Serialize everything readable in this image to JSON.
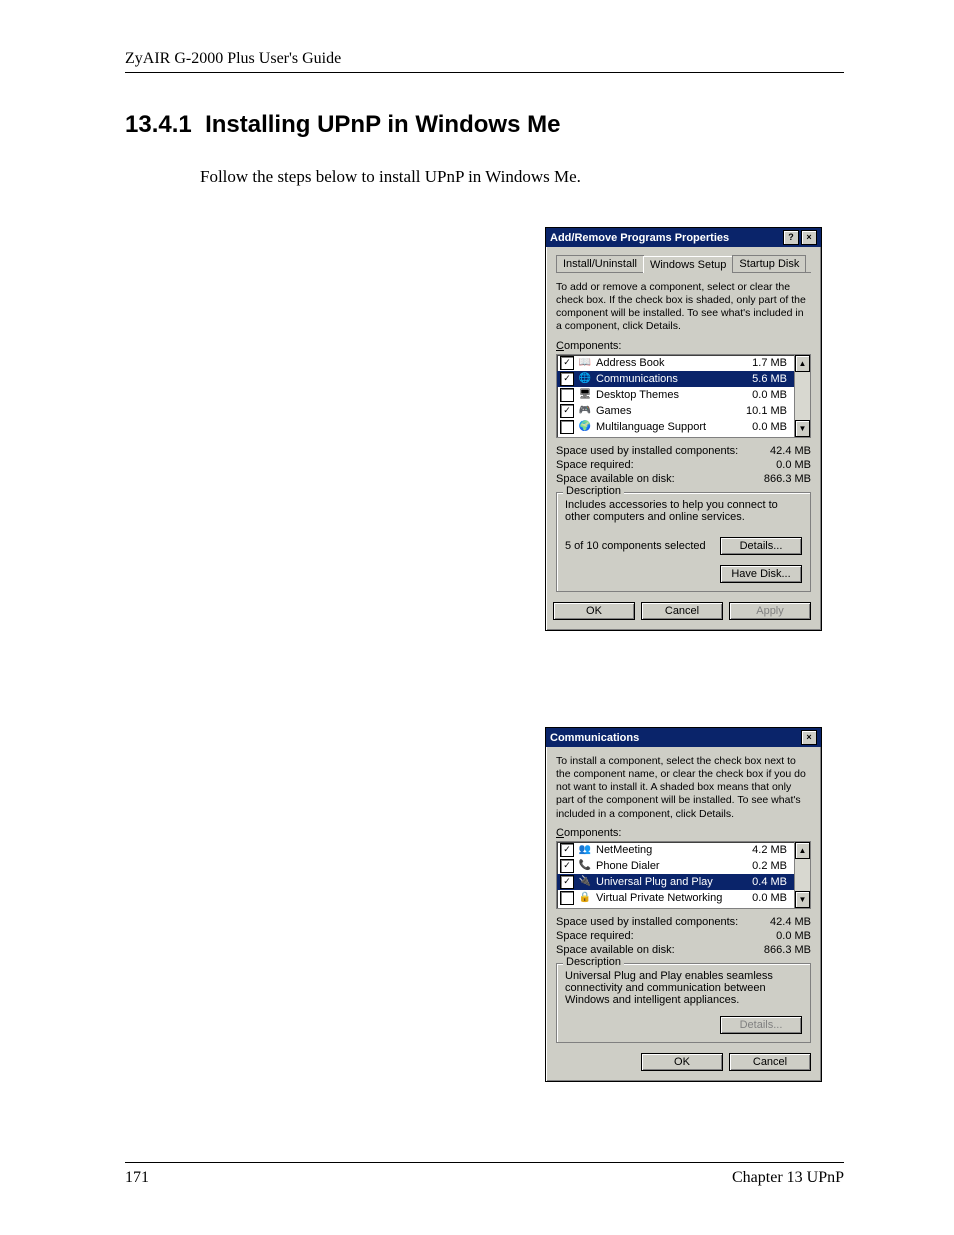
{
  "header": "ZyAIR G-2000 Plus User's Guide",
  "section_number": "13.4.1",
  "section_title": "Installing UPnP in Windows Me",
  "intro": "Follow the steps below to install UPnP in Windows Me.",
  "footer_left": "171",
  "footer_right": "Chapter 13 UPnP",
  "dialog1": {
    "title": "Add/Remove Programs Properties",
    "tabs": [
      "Install/Uninstall",
      "Windows Setup",
      "Startup Disk"
    ],
    "active_tab": 1,
    "hint": "To add or remove a component, select or clear the check box. If the check box is shaded, only part of the component will be installed. To see what's included in a component, click Details.",
    "components_label": "Components:",
    "items": [
      {
        "checked": true,
        "icon": "📖",
        "name": "Address Book",
        "size": "1.7 MB",
        "selected": false
      },
      {
        "checked": true,
        "icon": "🌐",
        "name": "Communications",
        "size": "5.6 MB",
        "selected": true
      },
      {
        "checked": false,
        "icon": "🖥",
        "name": "Desktop Themes",
        "size": "0.0 MB",
        "selected": false
      },
      {
        "checked": true,
        "icon": "🎮",
        "name": "Games",
        "size": "10.1 MB",
        "selected": false
      },
      {
        "checked": false,
        "icon": "🌍",
        "name": "Multilanguage Support",
        "size": "0.0 MB",
        "selected": false
      }
    ],
    "stats": [
      {
        "label": "Space used by installed components:",
        "value": "42.4 MB"
      },
      {
        "label": "Space required:",
        "value": "0.0 MB"
      },
      {
        "label": "Space available on disk:",
        "value": "866.3 MB"
      }
    ],
    "desc_label": "Description",
    "description": "Includes accessories to help you connect to other computers and online services.",
    "selected_text": "5 of 10 components selected",
    "details_btn": "Details...",
    "have_disk_btn": "Have Disk...",
    "ok": "OK",
    "cancel": "Cancel",
    "apply": "Apply"
  },
  "dialog2": {
    "title": "Communications",
    "hint": "To install a component, select the check box next to the component name, or clear the check box if you do not want to install it. A shaded box means that only part of the component will be installed. To see what's included in a component, click Details.",
    "components_label": "Components:",
    "items": [
      {
        "checked": true,
        "icon": "👥",
        "name": "NetMeeting",
        "size": "4.2 MB",
        "selected": false
      },
      {
        "checked": true,
        "icon": "📞",
        "name": "Phone Dialer",
        "size": "0.2 MB",
        "selected": false
      },
      {
        "checked": true,
        "icon": "🔌",
        "name": "Universal Plug and Play",
        "size": "0.4 MB",
        "selected": true
      },
      {
        "checked": false,
        "icon": "🔒",
        "name": "Virtual Private Networking",
        "size": "0.0 MB",
        "selected": false
      }
    ],
    "stats": [
      {
        "label": "Space used by installed components:",
        "value": "42.4 MB"
      },
      {
        "label": "Space required:",
        "value": "0.0 MB"
      },
      {
        "label": "Space available on disk:",
        "value": "866.3 MB"
      }
    ],
    "desc_label": "Description",
    "description": "Universal Plug and Play enables seamless connectivity and communication between Windows and intelligent appliances.",
    "details_btn": "Details...",
    "ok": "OK",
    "cancel": "Cancel"
  }
}
